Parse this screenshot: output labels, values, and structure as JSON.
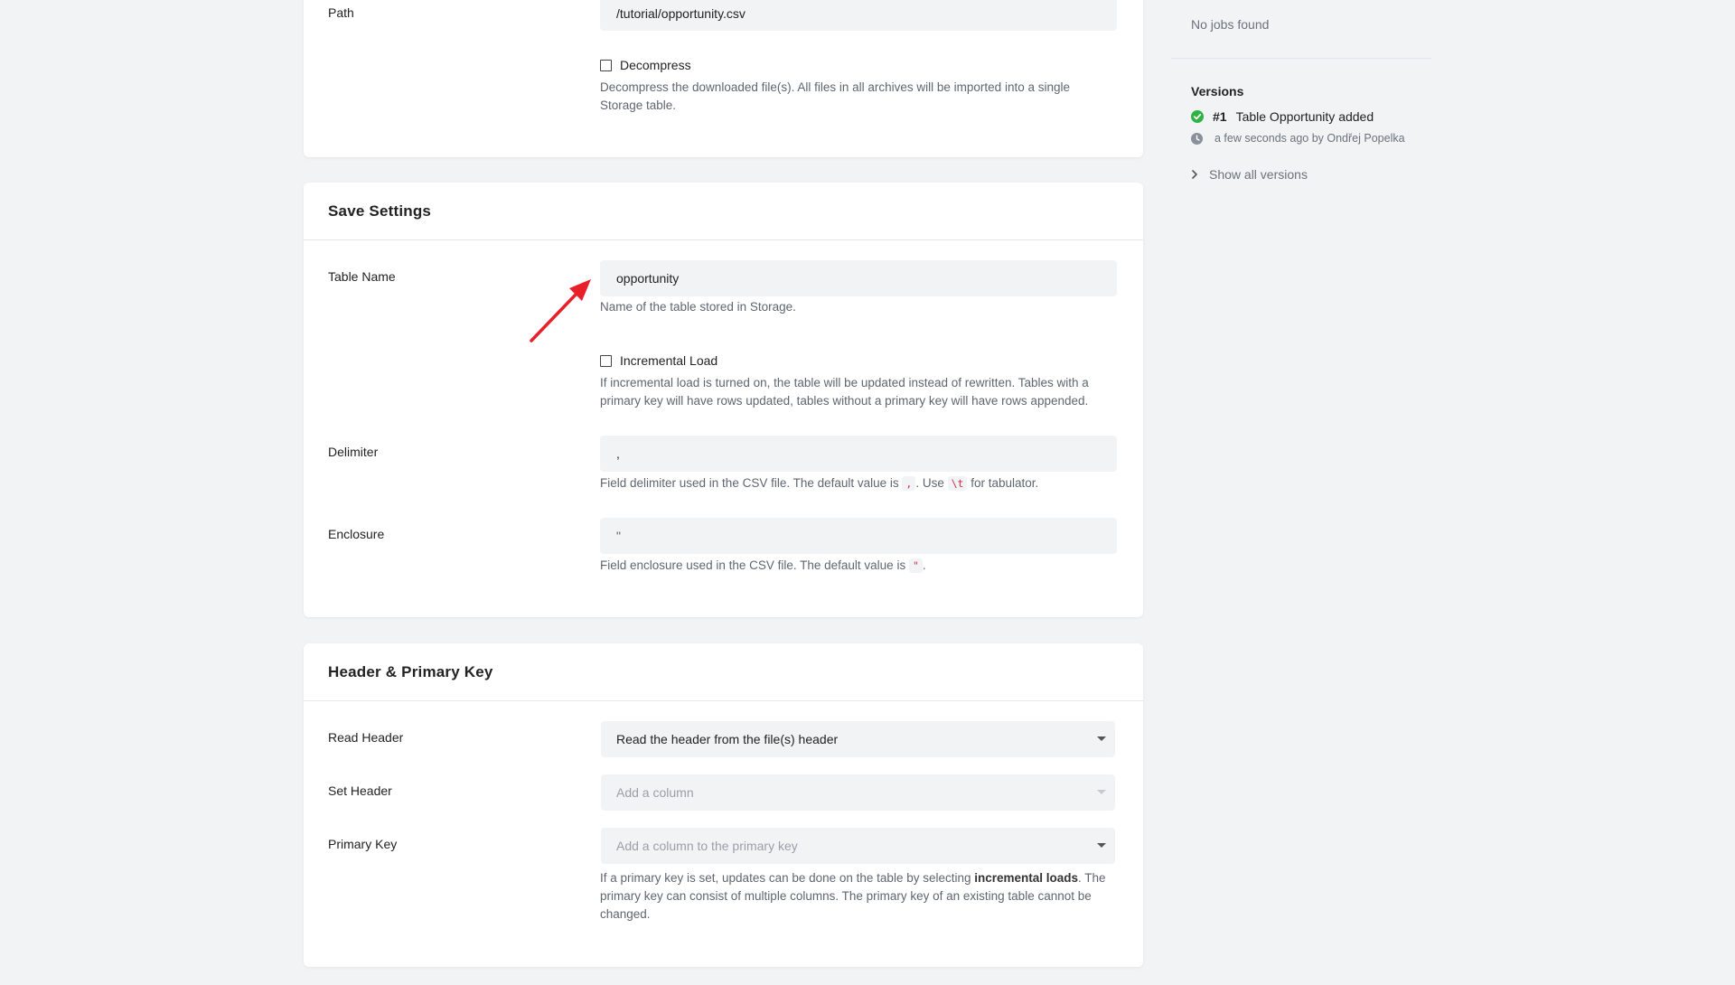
{
  "source_card": {
    "path_label": "Path",
    "path_value": "/tutorial/opportunity.csv",
    "decompress_label": "Decompress",
    "decompress_help": "Decompress the downloaded file(s). All files in all archives will be imported into a single Storage table."
  },
  "save_settings": {
    "title": "Save Settings",
    "table_name_label": "Table Name",
    "table_name_value": "opportunity",
    "table_name_help": "Name of the table stored in Storage.",
    "incremental_label": "Incremental Load",
    "incremental_help": "If incremental load is turned on, the table will be updated instead of rewritten. Tables with a primary key will have rows updated, tables without a primary key will have rows appended.",
    "delimiter_label": "Delimiter",
    "delimiter_value": ",",
    "delimiter_help_pre": "Field delimiter used in the CSV file. The default value is ",
    "delimiter_help_code1": ",",
    "delimiter_help_mid": ". Use ",
    "delimiter_help_code2": "\\t",
    "delimiter_help_post": " for tabulator.",
    "enclosure_label": "Enclosure",
    "enclosure_value": "\"",
    "enclosure_help_pre": "Field enclosure used in the CSV file. The default value is ",
    "enclosure_help_code": "\"",
    "enclosure_help_post": "."
  },
  "header_pk": {
    "title": "Header & Primary Key",
    "read_header_label": "Read Header",
    "read_header_value": "Read the header from the file(s) header",
    "set_header_label": "Set Header",
    "set_header_placeholder": "Add a column",
    "primary_key_label": "Primary Key",
    "primary_key_placeholder": "Add a column to the primary key",
    "pk_help_pre": "If a primary key is set, updates can be done on the table by selecting ",
    "pk_help_bold": "incremental loads",
    "pk_help_post": ". The primary key can consist of multiple columns. The primary key of an existing table cannot be changed."
  },
  "sidebar": {
    "last_runs_empty": "No jobs found",
    "versions_title": "Versions",
    "version_number": "#1",
    "version_desc": "Table Opportunity added",
    "version_meta": "a few seconds ago by Ondřej Popelka",
    "show_all": "Show all versions"
  },
  "colors": {
    "success": "#2fb344",
    "annotation_arrow": "#e8202a"
  },
  "icons": [
    "check-circle-icon",
    "clock-icon",
    "chevron-right-icon",
    "caret-down-icon",
    "checkbox-icon",
    "arrow-annotation-icon"
  ]
}
